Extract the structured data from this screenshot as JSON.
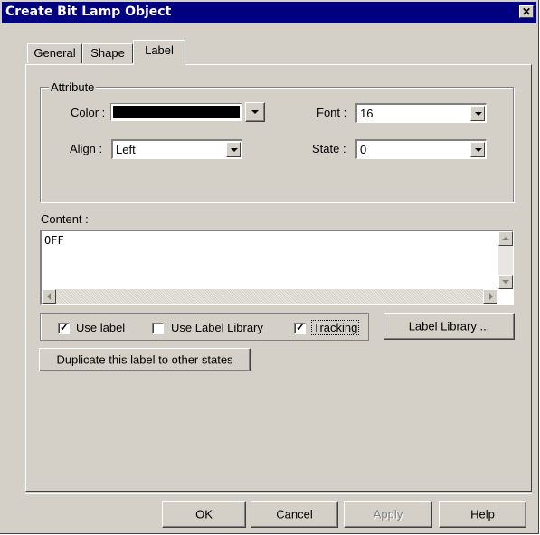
{
  "window": {
    "title": "Create Bit Lamp  Object",
    "close_symbol": "✕"
  },
  "tabs": [
    {
      "label": "General",
      "active": false
    },
    {
      "label": "Shape",
      "active": false
    },
    {
      "label": "Label",
      "active": true
    }
  ],
  "attribute": {
    "group_label": "Attribute",
    "color_label": "Color :",
    "color_value": "#000000",
    "font_label": "Font :",
    "font_value": "16",
    "align_label": "Align :",
    "align_value": "Left",
    "state_label": "State :",
    "state_value": "0"
  },
  "content": {
    "label": "Content :",
    "text": "OFF"
  },
  "options": {
    "use_label": {
      "label": "Use label",
      "checked": true
    },
    "use_label_library": {
      "label": "Use Label Library",
      "checked": false
    },
    "tracking": {
      "label": "Tracking",
      "checked": true
    },
    "label_library_button": "Label Library ...",
    "duplicate_button": "Duplicate this label to other states"
  },
  "footer": {
    "ok": "OK",
    "cancel": "Cancel",
    "apply": "Apply",
    "help": "Help"
  },
  "icons": [
    "close-icon",
    "dropdown-arrow-icon",
    "scroll-up-icon",
    "scroll-down-icon",
    "scroll-left-icon",
    "scroll-right-icon",
    "check-icon"
  ]
}
